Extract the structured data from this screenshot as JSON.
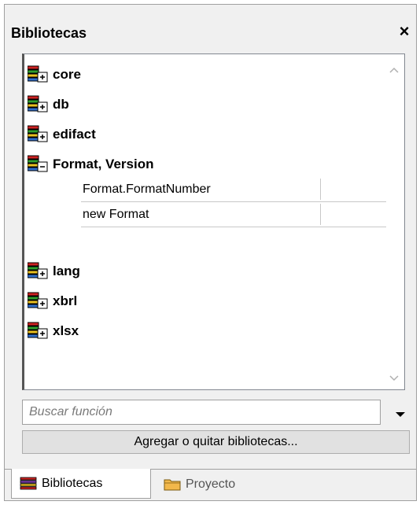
{
  "panel": {
    "title": "Bibliotecas",
    "close_label": "×"
  },
  "tree": {
    "libraries": [
      {
        "name": "core",
        "state": "collapsed"
      },
      {
        "name": "db",
        "state": "collapsed"
      },
      {
        "name": "edifact",
        "state": "collapsed"
      },
      {
        "name": "Format, Version",
        "state": "expanded"
      },
      {
        "name": "lang",
        "state": "collapsed"
      },
      {
        "name": "xbrl",
        "state": "collapsed"
      },
      {
        "name": "xlsx",
        "state": "collapsed"
      }
    ],
    "expanded_functions": [
      "Format.FormatNumber",
      "new Format"
    ]
  },
  "search": {
    "placeholder": "Buscar función",
    "value": ""
  },
  "add_button_label": "Agregar o quitar bibliotecas...",
  "tabs": [
    {
      "label": "Bibliotecas",
      "active": true
    },
    {
      "label": "Proyecto",
      "active": false
    }
  ],
  "colors": {
    "panel_bg": "#f0f0f0",
    "tree_bg": "#ffffff",
    "book_green": "#2e9e2e",
    "book_red": "#cc2222",
    "book_yellow": "#e8c020",
    "folder_orange": "#e8a030"
  }
}
